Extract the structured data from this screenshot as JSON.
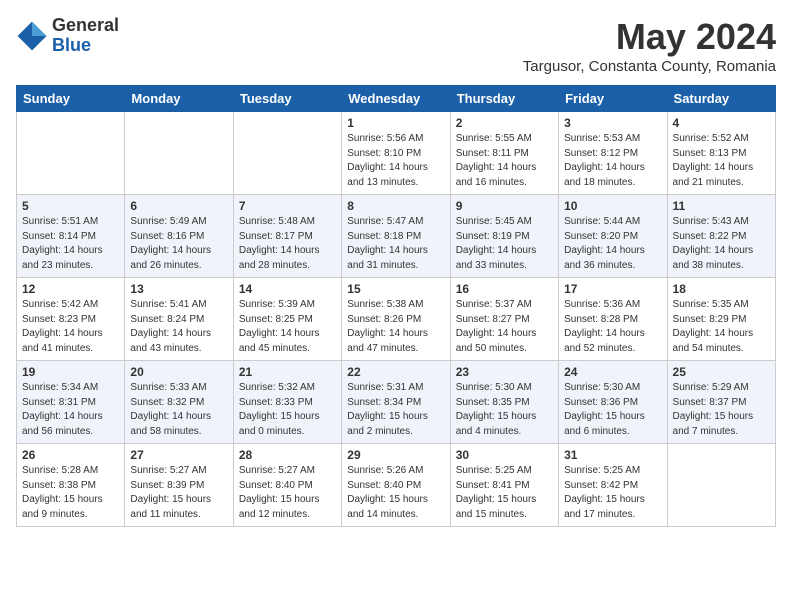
{
  "logo": {
    "general": "General",
    "blue": "Blue"
  },
  "title": "May 2024",
  "location": "Targusor, Constanta County, Romania",
  "days_of_week": [
    "Sunday",
    "Monday",
    "Tuesday",
    "Wednesday",
    "Thursday",
    "Friday",
    "Saturday"
  ],
  "weeks": [
    [
      {
        "day": "",
        "info": ""
      },
      {
        "day": "",
        "info": ""
      },
      {
        "day": "",
        "info": ""
      },
      {
        "day": "1",
        "info": "Sunrise: 5:56 AM\nSunset: 8:10 PM\nDaylight: 14 hours\nand 13 minutes."
      },
      {
        "day": "2",
        "info": "Sunrise: 5:55 AM\nSunset: 8:11 PM\nDaylight: 14 hours\nand 16 minutes."
      },
      {
        "day": "3",
        "info": "Sunrise: 5:53 AM\nSunset: 8:12 PM\nDaylight: 14 hours\nand 18 minutes."
      },
      {
        "day": "4",
        "info": "Sunrise: 5:52 AM\nSunset: 8:13 PM\nDaylight: 14 hours\nand 21 minutes."
      }
    ],
    [
      {
        "day": "5",
        "info": "Sunrise: 5:51 AM\nSunset: 8:14 PM\nDaylight: 14 hours\nand 23 minutes."
      },
      {
        "day": "6",
        "info": "Sunrise: 5:49 AM\nSunset: 8:16 PM\nDaylight: 14 hours\nand 26 minutes."
      },
      {
        "day": "7",
        "info": "Sunrise: 5:48 AM\nSunset: 8:17 PM\nDaylight: 14 hours\nand 28 minutes."
      },
      {
        "day": "8",
        "info": "Sunrise: 5:47 AM\nSunset: 8:18 PM\nDaylight: 14 hours\nand 31 minutes."
      },
      {
        "day": "9",
        "info": "Sunrise: 5:45 AM\nSunset: 8:19 PM\nDaylight: 14 hours\nand 33 minutes."
      },
      {
        "day": "10",
        "info": "Sunrise: 5:44 AM\nSunset: 8:20 PM\nDaylight: 14 hours\nand 36 minutes."
      },
      {
        "day": "11",
        "info": "Sunrise: 5:43 AM\nSunset: 8:22 PM\nDaylight: 14 hours\nand 38 minutes."
      }
    ],
    [
      {
        "day": "12",
        "info": "Sunrise: 5:42 AM\nSunset: 8:23 PM\nDaylight: 14 hours\nand 41 minutes."
      },
      {
        "day": "13",
        "info": "Sunrise: 5:41 AM\nSunset: 8:24 PM\nDaylight: 14 hours\nand 43 minutes."
      },
      {
        "day": "14",
        "info": "Sunrise: 5:39 AM\nSunset: 8:25 PM\nDaylight: 14 hours\nand 45 minutes."
      },
      {
        "day": "15",
        "info": "Sunrise: 5:38 AM\nSunset: 8:26 PM\nDaylight: 14 hours\nand 47 minutes."
      },
      {
        "day": "16",
        "info": "Sunrise: 5:37 AM\nSunset: 8:27 PM\nDaylight: 14 hours\nand 50 minutes."
      },
      {
        "day": "17",
        "info": "Sunrise: 5:36 AM\nSunset: 8:28 PM\nDaylight: 14 hours\nand 52 minutes."
      },
      {
        "day": "18",
        "info": "Sunrise: 5:35 AM\nSunset: 8:29 PM\nDaylight: 14 hours\nand 54 minutes."
      }
    ],
    [
      {
        "day": "19",
        "info": "Sunrise: 5:34 AM\nSunset: 8:31 PM\nDaylight: 14 hours\nand 56 minutes."
      },
      {
        "day": "20",
        "info": "Sunrise: 5:33 AM\nSunset: 8:32 PM\nDaylight: 14 hours\nand 58 minutes."
      },
      {
        "day": "21",
        "info": "Sunrise: 5:32 AM\nSunset: 8:33 PM\nDaylight: 15 hours\nand 0 minutes."
      },
      {
        "day": "22",
        "info": "Sunrise: 5:31 AM\nSunset: 8:34 PM\nDaylight: 15 hours\nand 2 minutes."
      },
      {
        "day": "23",
        "info": "Sunrise: 5:30 AM\nSunset: 8:35 PM\nDaylight: 15 hours\nand 4 minutes."
      },
      {
        "day": "24",
        "info": "Sunrise: 5:30 AM\nSunset: 8:36 PM\nDaylight: 15 hours\nand 6 minutes."
      },
      {
        "day": "25",
        "info": "Sunrise: 5:29 AM\nSunset: 8:37 PM\nDaylight: 15 hours\nand 7 minutes."
      }
    ],
    [
      {
        "day": "26",
        "info": "Sunrise: 5:28 AM\nSunset: 8:38 PM\nDaylight: 15 hours\nand 9 minutes."
      },
      {
        "day": "27",
        "info": "Sunrise: 5:27 AM\nSunset: 8:39 PM\nDaylight: 15 hours\nand 11 minutes."
      },
      {
        "day": "28",
        "info": "Sunrise: 5:27 AM\nSunset: 8:40 PM\nDaylight: 15 hours\nand 12 minutes."
      },
      {
        "day": "29",
        "info": "Sunrise: 5:26 AM\nSunset: 8:40 PM\nDaylight: 15 hours\nand 14 minutes."
      },
      {
        "day": "30",
        "info": "Sunrise: 5:25 AM\nSunset: 8:41 PM\nDaylight: 15 hours\nand 15 minutes."
      },
      {
        "day": "31",
        "info": "Sunrise: 5:25 AM\nSunset: 8:42 PM\nDaylight: 15 hours\nand 17 minutes."
      },
      {
        "day": "",
        "info": ""
      }
    ]
  ]
}
